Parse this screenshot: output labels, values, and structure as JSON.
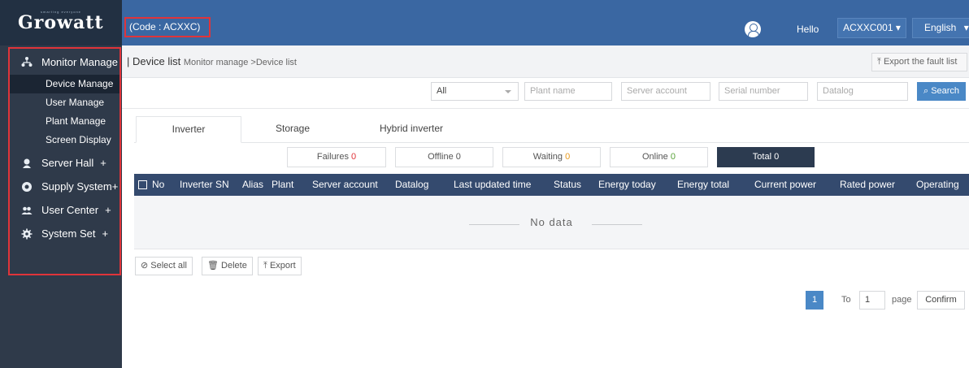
{
  "logo": {
    "text": "Growatt",
    "tagline": "smarting everyone"
  },
  "header": {
    "code": "(Code : ACXXC)",
    "greeting": "Hello",
    "account": "ACXXC001",
    "language": "English"
  },
  "sidebar": {
    "monitor": {
      "label": "Monitor Manage",
      "icon": "network-icon"
    },
    "sub_items": [
      {
        "label": "Device Manage",
        "active": true
      },
      {
        "label": "User Manage"
      },
      {
        "label": "Plant Manage"
      },
      {
        "label": "Screen Display"
      }
    ],
    "groups": [
      {
        "label": "Server Hall",
        "icon": "server-hall-icon",
        "expand": "+"
      },
      {
        "label": "Supply System",
        "icon": "supply-system-icon",
        "expand": "+"
      },
      {
        "label": "User Center",
        "icon": "users-icon",
        "expand": "+"
      },
      {
        "label": "System Set",
        "icon": "gear-icon",
        "expand": "+"
      }
    ]
  },
  "breadcrumb": {
    "title": "Device list",
    "path": "Monitor manage >Device list",
    "export_fault": "Export the fault list"
  },
  "filters": {
    "type_selected": "All",
    "plant_name_placeholder": "Plant name",
    "server_account_placeholder": "Server account",
    "serial_number_placeholder": "Serial number",
    "datalog_placeholder": "Datalog",
    "search_label": "Search"
  },
  "tabs": [
    {
      "label": "Inverter",
      "active": true
    },
    {
      "label": "Storage"
    },
    {
      "label": "Hybrid inverter"
    }
  ],
  "status": {
    "failures": {
      "label": "Failures",
      "count": "0"
    },
    "offline": {
      "label": "Offline",
      "count": "0"
    },
    "waiting": {
      "label": "Waiting",
      "count": "0"
    },
    "online": {
      "label": "Online",
      "count": "0"
    },
    "total": {
      "label": "Total",
      "count": "0"
    }
  },
  "table": {
    "columns": [
      "No",
      "Inverter SN",
      "Alias",
      "Plant",
      "Server account",
      "Datalog",
      "Last updated time",
      "Status",
      "Energy today",
      "Energy total",
      "Current power",
      "Rated power",
      "Operating"
    ],
    "empty_text": "No data"
  },
  "actions": {
    "select_all": "Select all",
    "delete": "Delete",
    "export": "Export"
  },
  "pagination": {
    "current_page": "1",
    "to_label": "To",
    "page_input": "1",
    "page_label": "page",
    "confirm": "Confirm"
  },
  "colors": {
    "sidebar_bg": "#2f3a4a",
    "topbar_bg": "#3a67a2",
    "table_header_bg": "#344a6e",
    "accent": "#4a88c6",
    "highlight_border": "#e0343a"
  }
}
